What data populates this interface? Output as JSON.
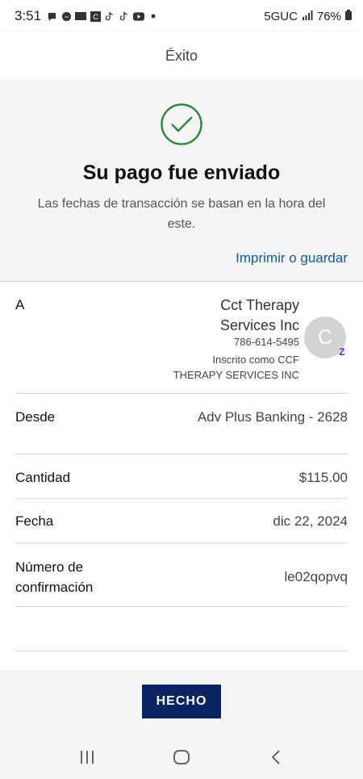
{
  "status_bar": {
    "time": "3:51",
    "app_icons": [
      "chat-bubble-icon",
      "messenger-icon",
      "temu-icon",
      "c-app-icon",
      "tiktok-icon",
      "tiktok-icon",
      "youtube-icon",
      "dot-icon"
    ],
    "network": "5GUC",
    "battery": "76%"
  },
  "header": {
    "title": "Éxito"
  },
  "confirmation": {
    "title": "Su pago fue enviado",
    "subtitle": "Las fechas de transacción se basan en la hora del este.",
    "print_link": "Imprimir o guardar"
  },
  "details": {
    "to": {
      "label": "A",
      "name": "Cct Therapy Services Inc",
      "phone": "786-614-5495",
      "enrolled": "Inscrito como CCF THERAPY SERVICES INC",
      "avatar_letter": "C",
      "badge": "Z"
    },
    "from": {
      "label": "Desde",
      "value": "Adv Plus Banking - 2628"
    },
    "amount": {
      "label": "Cantidad",
      "value": "$115.00"
    },
    "date": {
      "label": "Fecha",
      "value": "dic 22, 2024"
    },
    "confirmation_number": {
      "label": "Número de confirmación",
      "value": "le02qopvq"
    }
  },
  "actions": {
    "done_label": "HECHO"
  },
  "colors": {
    "accent": "#0a2463",
    "link": "#0b5d9e",
    "success": "#2e8b3a"
  }
}
